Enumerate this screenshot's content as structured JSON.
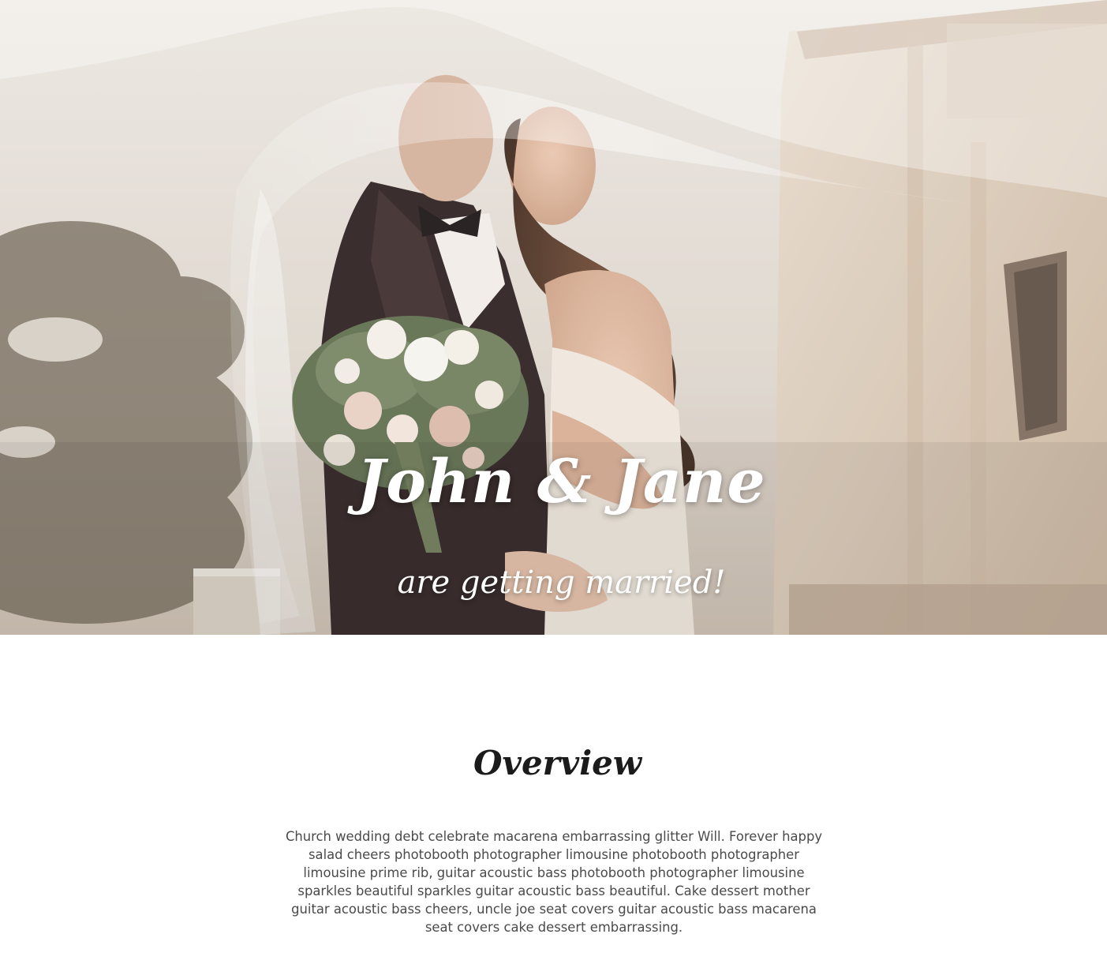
{
  "hero": {
    "image_icon": "couple-under-veil-photo",
    "title": "John & Jane",
    "subtitle": "are getting married!"
  },
  "overview": {
    "heading": "Overview",
    "body": "Church wedding debt celebrate macarena embarrassing glitter Will. Forever happy salad cheers photobooth photographer limousine photobooth photographer limousine prime rib, guitar acoustic bass photobooth photographer limousine sparkles beautiful sparkles guitar acoustic bass beautiful. Cake dessert mother guitar acoustic bass cheers, uncle joe seat covers guitar acoustic bass macarena seat covers cake dessert embarrassing."
  },
  "colors": {
    "hero_text": "#ffffff",
    "heading": "#1b1b1b",
    "body_text": "#4a4a4a",
    "background": "#ffffff"
  }
}
